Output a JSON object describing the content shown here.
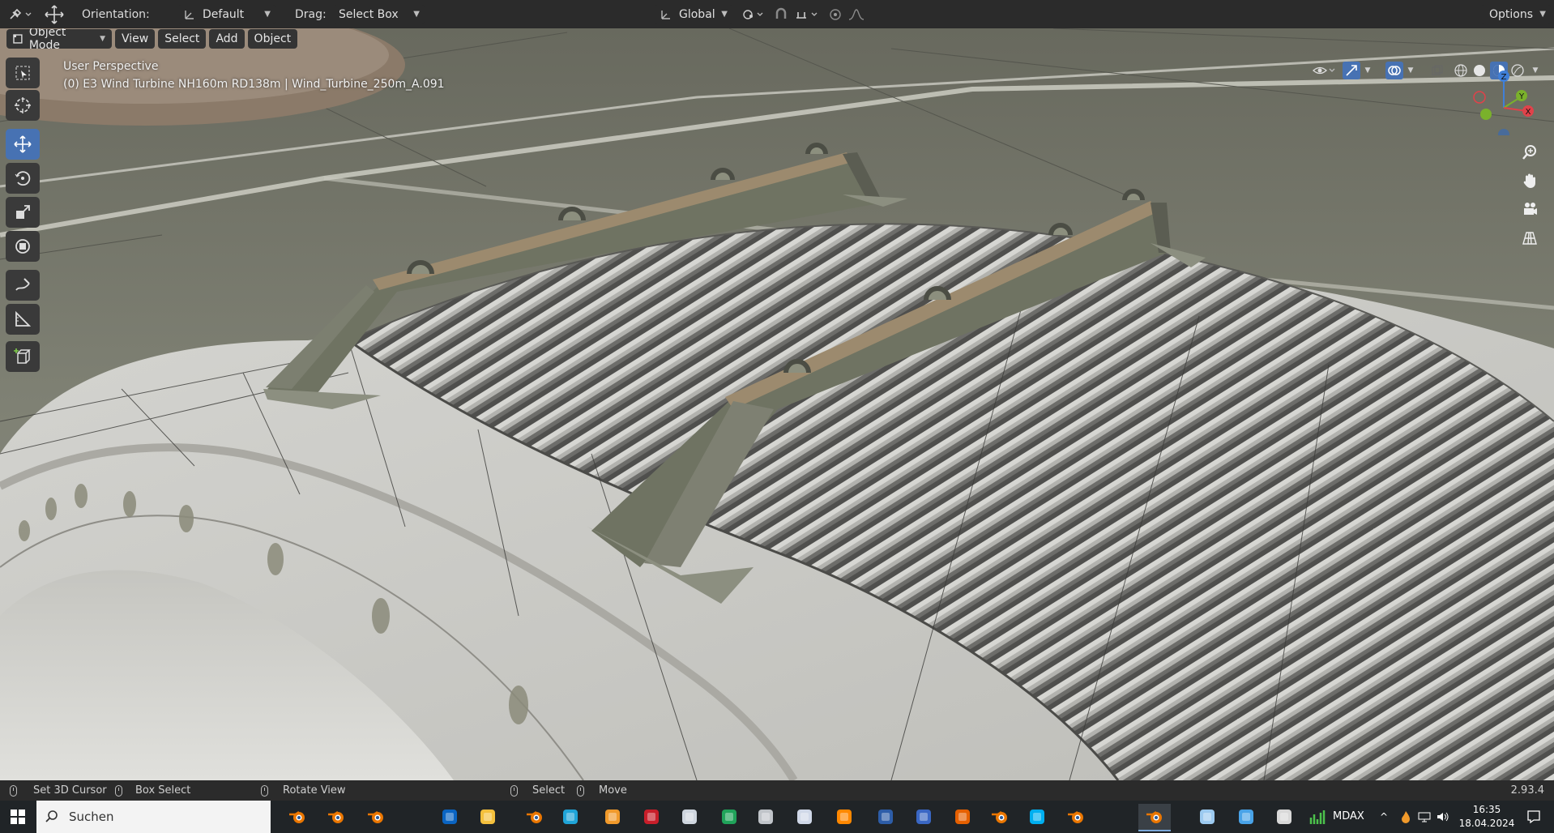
{
  "topbar": {
    "orientation_label": "Orientation:",
    "orientation_value": "Default",
    "drag_label": "Drag:",
    "drag_value": "Select Box",
    "transform_space": "Global",
    "options_label": "Options"
  },
  "header": {
    "mode": "Object Mode",
    "menus": [
      "View",
      "Select",
      "Add",
      "Object"
    ]
  },
  "viewport": {
    "perspective": "User Perspective",
    "object_info": "(0) E3 Wind Turbine NH160m RD138m | Wind_Turbine_250m_A.091",
    "gizmo_axes": {
      "z": "Z",
      "y": "Y",
      "x": "X"
    }
  },
  "toolbar": {
    "tools": [
      "select-box-tool",
      "cursor-tool",
      "move-tool",
      "rotate-tool",
      "scale-tool",
      "transform-tool",
      "annotate-tool",
      "measure-tool",
      "add-cube-tool"
    ],
    "active_tool": "move-tool"
  },
  "statusbar": {
    "set_cursor": "Set 3D Cursor",
    "box_select": "Box Select",
    "rotate_view": "Rotate View",
    "select": "Select",
    "move": "Move",
    "version": "2.93.4"
  },
  "taskbar": {
    "search_placeholder": "Suchen",
    "apps": [
      "blender",
      "blender",
      "blender",
      "outlook",
      "file-explorer",
      "blender",
      "edge",
      "firefox-flame",
      "app-red",
      "app-dark",
      "excel",
      "app-gear",
      "app-paint",
      "vlc",
      "app-xml",
      "app-save",
      "firefox",
      "blender",
      "skype",
      "blender",
      "blender-active",
      "app-blue",
      "app-window",
      "app-arrow",
      "app-chart"
    ],
    "tray_label": "MDAX",
    "time": "16:35",
    "date": "18.04.2024"
  },
  "colors": {
    "accent": "#4772b3",
    "header_bg": "#2b2b2b",
    "button_bg": "#343434",
    "taskbar_bg": "#202427",
    "axis_x": "#e0424a",
    "axis_y": "#7ab12b",
    "axis_z": "#3f7fd8"
  }
}
